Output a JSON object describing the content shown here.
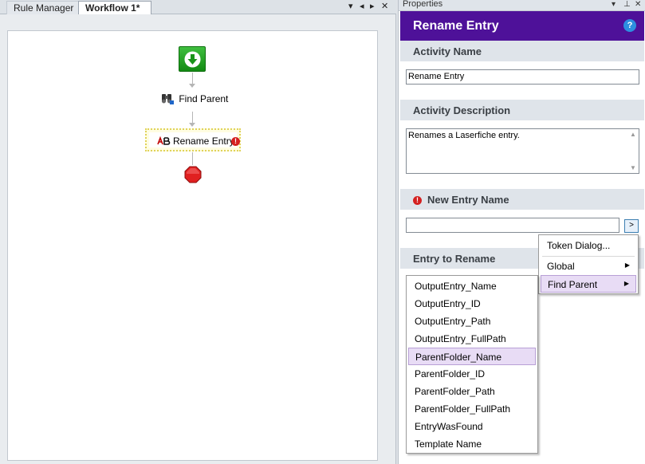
{
  "tabs": [
    {
      "label": "Rule Manager"
    },
    {
      "label": "Workflow 1*"
    }
  ],
  "tab_controls": {
    "pin": "▾",
    "prev": "◂",
    "next": "▸",
    "close": "✕"
  },
  "workflow": {
    "activities": {
      "find_parent": "Find Parent",
      "rename_entry": "Rename Entry"
    },
    "error_marker": "!"
  },
  "properties": {
    "panel_title": "Properties",
    "panel_controls": {
      "pin": "▾",
      "dock": "⊥",
      "close": "✕"
    },
    "header_title": "Rename Entry",
    "help_icon": "?",
    "activity_name_label": "Activity Name",
    "activity_name_value": "Rename Entry",
    "activity_description_label": "Activity Description",
    "activity_description_value": "Renames a Laserfiche entry.",
    "new_entry_name_label": "New Entry Name",
    "new_entry_name_value": "",
    "token_button": ">",
    "entry_to_rename_label": "Entry to Rename",
    "error_marker": "!"
  },
  "token_menu": {
    "items": [
      {
        "label": "Token Dialog..."
      },
      {
        "label": "Global",
        "submenu": "▶"
      },
      {
        "label": "Find Parent",
        "submenu": "▶",
        "highlighted": true
      }
    ]
  },
  "find_parent_submenu": {
    "items": [
      {
        "label": "OutputEntry_Name"
      },
      {
        "label": "OutputEntry_ID"
      },
      {
        "label": "OutputEntry_Path"
      },
      {
        "label": "OutputEntry_FullPath"
      },
      {
        "label": "ParentFolder_Name",
        "highlighted": true
      },
      {
        "label": "ParentFolder_ID"
      },
      {
        "label": "ParentFolder_Path"
      },
      {
        "label": "ParentFolder_FullPath"
      },
      {
        "label": "EntryWasFound"
      },
      {
        "label": "Template Name"
      }
    ]
  },
  "colors": {
    "header_purple": "#4e1199",
    "start_green": "#1fa21f",
    "stop_red": "#e02020",
    "error_red": "#d42020",
    "highlight_lavender": "#e8dcf5"
  }
}
